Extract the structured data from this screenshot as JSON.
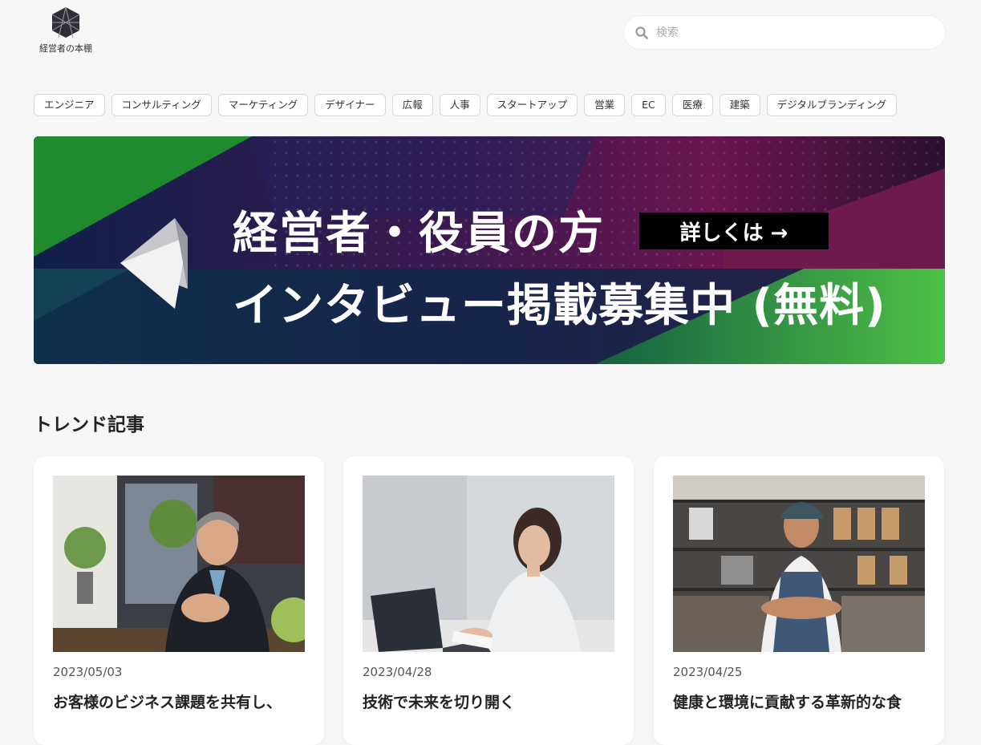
{
  "logo": {
    "text": "経営者の本棚"
  },
  "search": {
    "placeholder": "検索"
  },
  "tags": [
    "エンジニア",
    "コンサルティング",
    "マーケティング",
    "デザイナー",
    "広報",
    "人事",
    "スタートアップ",
    "営業",
    "EC",
    "医療",
    "建築",
    "デジタルブランディング"
  ],
  "banner": {
    "line1": "経営者・役員の方",
    "line2": "インタビュー掲載募集中 (無料)",
    "cta": "詳しくは →"
  },
  "section": {
    "title": "トレンド記事"
  },
  "articles": [
    {
      "date": "2023/05/03",
      "title": "お客様のビジネス課題を共有し、"
    },
    {
      "date": "2023/04/28",
      "title": "技術で未来を切り開く"
    },
    {
      "date": "2023/04/25",
      "title": "健康と環境に貢献する革新的な食"
    }
  ],
  "colors": {
    "background": "#f7f7f7",
    "banner_green": "#1f8a2e",
    "banner_purple": "#5a1647",
    "banner_navy": "#0f1e44"
  }
}
